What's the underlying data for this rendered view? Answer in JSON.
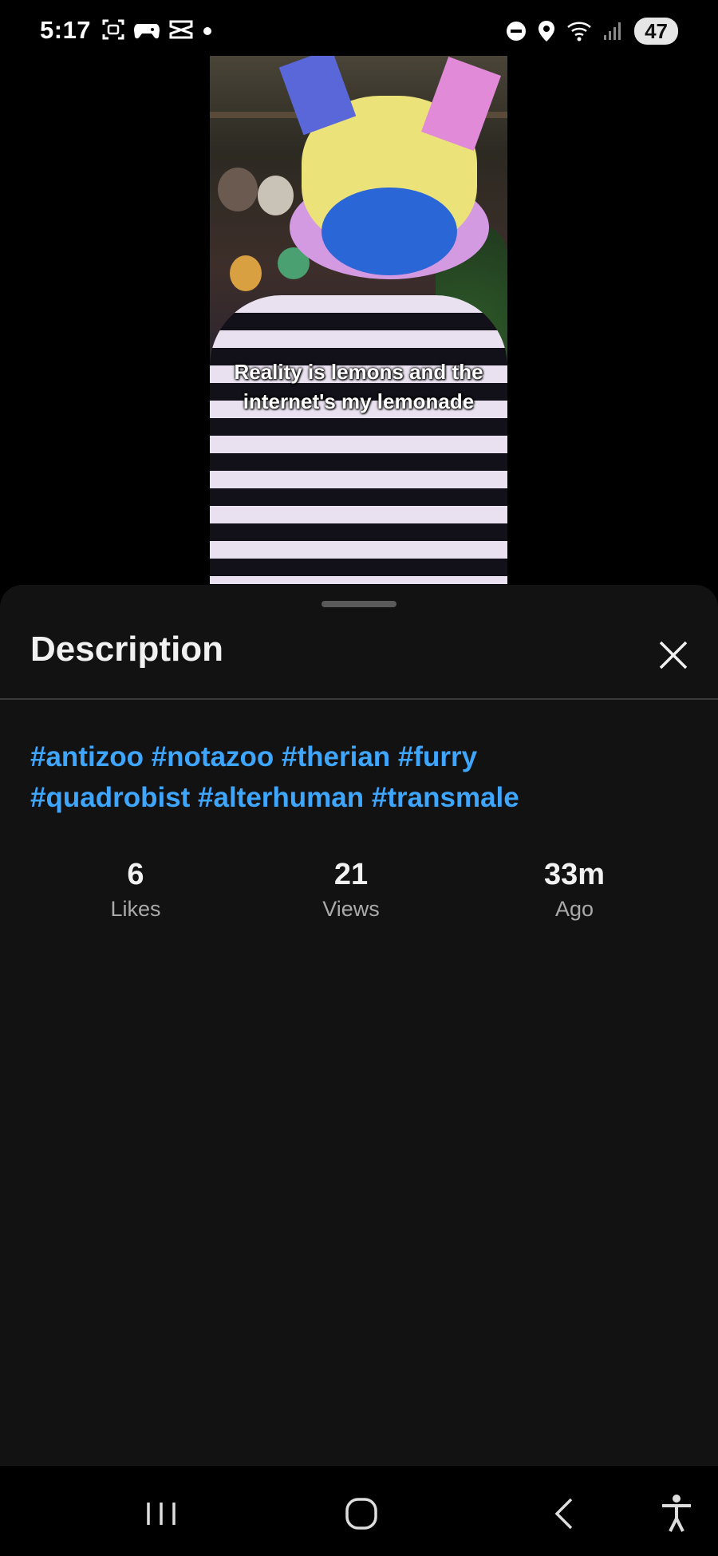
{
  "status_bar": {
    "time": "5:17",
    "battery": "47",
    "left_icons": [
      "screenshot-icon",
      "game-controller-icon",
      "capcut-icon",
      "notification-dot-icon"
    ],
    "right_icons": [
      "do-not-disturb-icon",
      "location-icon",
      "wifi-icon",
      "signal-icon"
    ]
  },
  "video": {
    "caption_line1": "Reality is lemons and the",
    "caption_line2": "internet's my lemonade"
  },
  "sheet": {
    "title": "Description",
    "hashtags_line1": [
      "#antizoo",
      "#notazoo",
      "#therian",
      "#furry"
    ],
    "hashtags_line2": [
      "#quadrobist",
      "#alterhuman",
      "#transmale"
    ],
    "stats": [
      {
        "value": "6",
        "label": "Likes"
      },
      {
        "value": "21",
        "label": "Views"
      },
      {
        "value": "33m",
        "label": "Ago"
      }
    ]
  },
  "nav_bar": {
    "buttons": [
      "recent-apps-icon",
      "home-icon",
      "back-icon",
      "accessibility-icon"
    ]
  },
  "colors": {
    "link": "#3ea6ff",
    "sheet_bg": "#121212",
    "text": "#f1f1f1",
    "muted": "#aaaaaa"
  }
}
